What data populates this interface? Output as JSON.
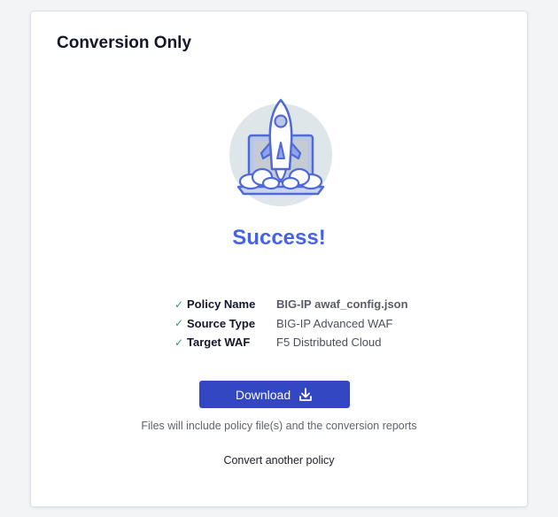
{
  "card": {
    "title": "Conversion Only"
  },
  "status": {
    "heading": "Success!",
    "illustration_icon": "rocket-laptop-illustration"
  },
  "details": [
    {
      "label": "Policy Name",
      "value": "BIG-IP awaf_config.json"
    },
    {
      "label": "Source Type",
      "value": "BIG-IP Advanced WAF"
    },
    {
      "label": "Target WAF",
      "value": "F5 Distributed Cloud"
    }
  ],
  "actions": {
    "download_label": "Download",
    "download_icon": "download-icon",
    "note": "Files will include policy file(s) and the conversion reports",
    "convert_another_label": "Convert another policy"
  },
  "colors": {
    "accent": "#3347c2",
    "success_heading": "#4763e4",
    "check": "#2e9e63"
  }
}
